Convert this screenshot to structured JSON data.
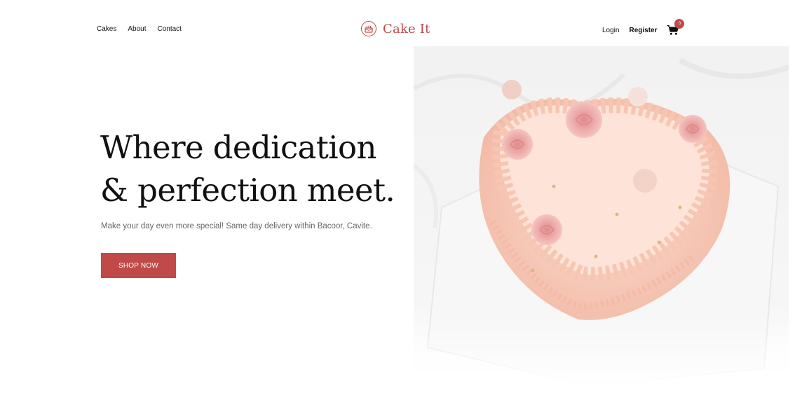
{
  "header": {
    "nav_left": [
      "Cakes",
      "About",
      "Contact"
    ],
    "brand": {
      "name": "Cake It",
      "logo_icon": "cake-icon"
    },
    "nav_right": {
      "login": "Login",
      "register": "Register",
      "cart_icon": "shopping-cart-icon",
      "cart_count": "0"
    }
  },
  "hero": {
    "title_line1": "Where dedication",
    "title_line2": "& perfection meet.",
    "subtitle": "Make your day even more special! Same day delivery within Bacoor, Cavite.",
    "cta_label": "SHOP NOW"
  },
  "colors": {
    "accent": "#c04a48",
    "text": "#111111",
    "muted": "#666666",
    "background": "#ffffff"
  }
}
